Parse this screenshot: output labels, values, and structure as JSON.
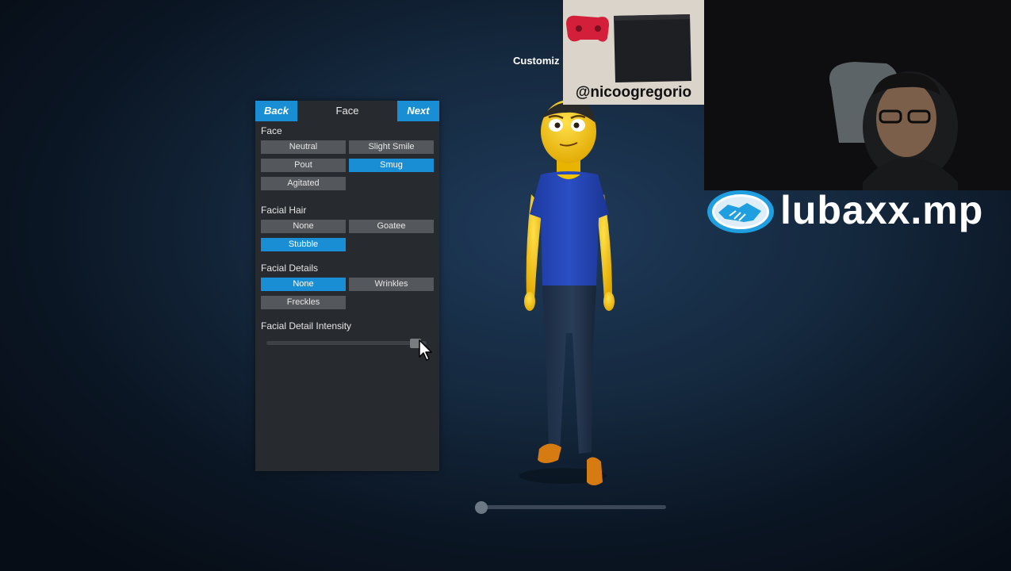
{
  "panel": {
    "back_label": "Back",
    "title": "Face",
    "next_label": "Next",
    "sections": {
      "face": {
        "label": "Face",
        "options": [
          "Neutral",
          "Slight Smile",
          "Pout",
          "Smug",
          "Agitated"
        ],
        "selected": "Smug"
      },
      "facial_hair": {
        "label": "Facial Hair",
        "options": [
          "None",
          "Goatee",
          "Stubble"
        ],
        "selected": "Stubble"
      },
      "facial_details": {
        "label": "Facial Details",
        "options": [
          "None",
          "Wrinkles",
          "Freckles"
        ],
        "selected": "None"
      }
    },
    "intensity": {
      "label": "Facial Detail Intensity",
      "value": 0.95
    }
  },
  "customize_title": "Customiz",
  "rotation_slider_value": 0.03,
  "overlays": {
    "handle": "@nicoogregorio",
    "sponsor_text": "lubaxx.mp"
  },
  "colors": {
    "accent": "#1a8ed4",
    "panel_bg": "#272a2e",
    "button_bg": "#54575b"
  }
}
